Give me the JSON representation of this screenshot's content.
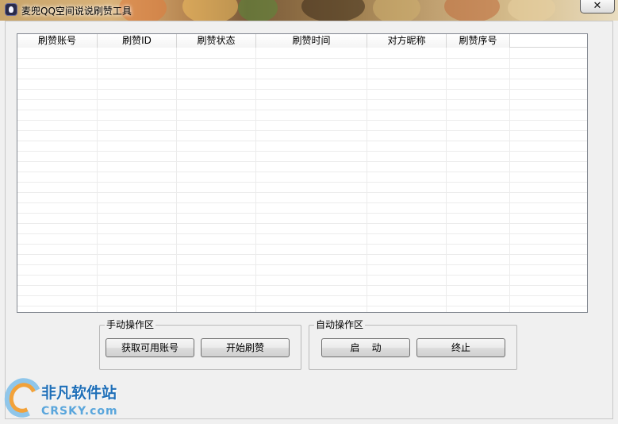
{
  "window": {
    "title": "麦兜QQ空间说说刷赞工具",
    "close_glyph": "✕"
  },
  "list": {
    "columns": [
      "刷赞账号",
      "刷赞ID",
      "刷赞状态",
      "刷赞时间",
      "对方昵称",
      "刷赞序号"
    ],
    "rows": []
  },
  "manual_group": {
    "label": "手动操作区",
    "get_accounts_label": "获取可用账号",
    "start_like_label": "开始刷赞"
  },
  "auto_group": {
    "label": "自动操作区",
    "start_label": "启    动",
    "stop_label": "终止"
  },
  "watermark": {
    "cn_text": "非凡软件站",
    "en_text": "CRSKY.com"
  }
}
